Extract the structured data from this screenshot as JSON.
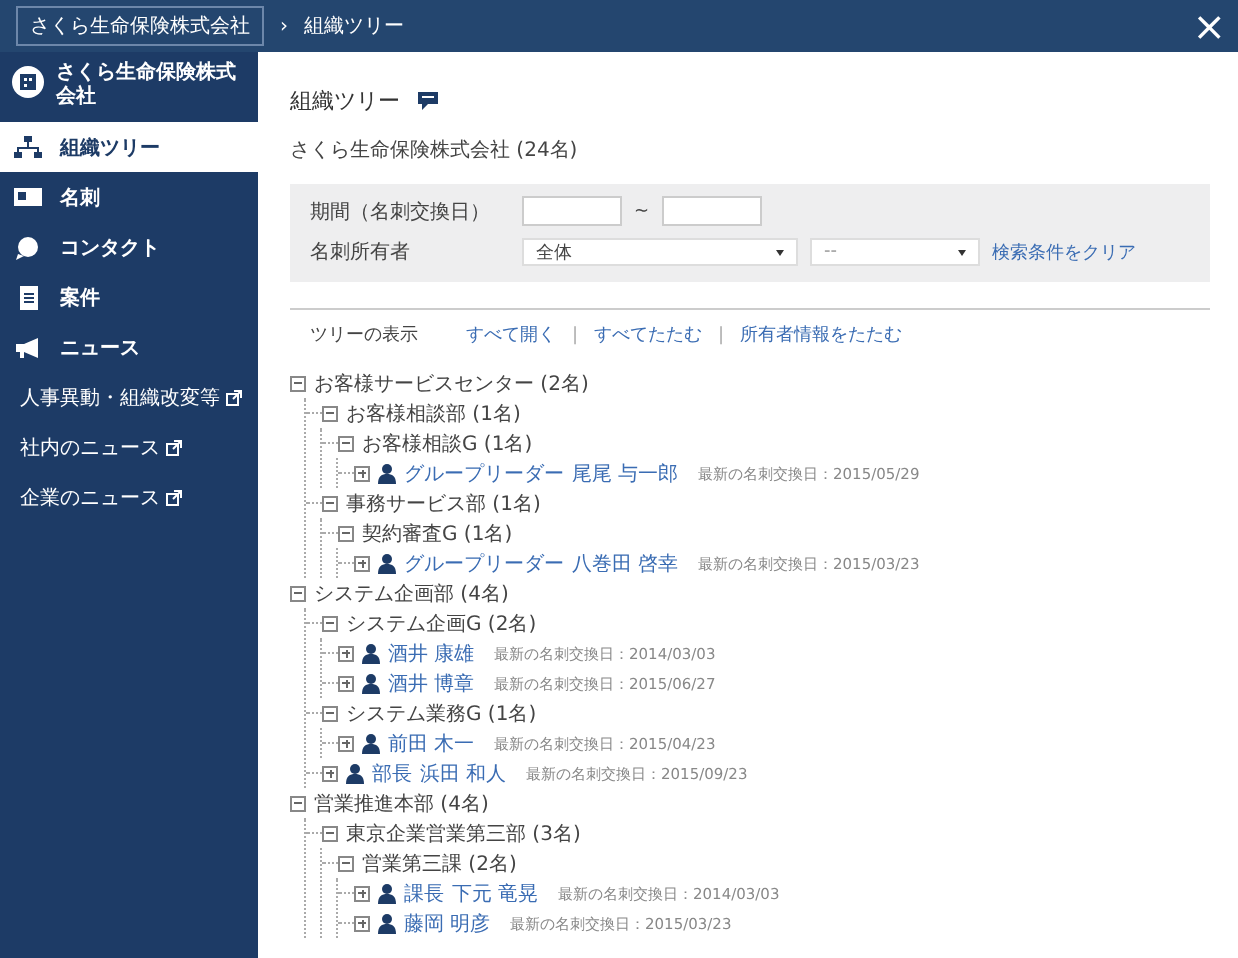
{
  "header": {
    "breadcrumb": [
      {
        "label": "さくら生命保険株式会社",
        "kind": "link"
      },
      {
        "label": "›",
        "kind": "separator"
      },
      {
        "label": "組織ツリー",
        "kind": "current"
      }
    ],
    "close": "×"
  },
  "sidebar": {
    "company": "さくら生命保険株式会社",
    "items": [
      {
        "label": "組織ツリー",
        "kind": "nav",
        "selected": true
      },
      {
        "label": "名刺",
        "kind": "nav",
        "selected": false
      },
      {
        "label": "コンタクト",
        "kind": "nav",
        "selected": false
      },
      {
        "label": "案件",
        "kind": "nav",
        "selected": false
      },
      {
        "label": "ニュース",
        "kind": "nav",
        "selected": false
      },
      {
        "label": "人事異動・組織改変等",
        "kind": "external",
        "selected": false
      },
      {
        "label": "社内のニュース",
        "kind": "external",
        "selected": false
      },
      {
        "label": "企業のニュース",
        "kind": "external",
        "selected": false
      }
    ]
  },
  "main": {
    "title": "組織ツリー",
    "company": "さくら生命保険株式会社 (24名)",
    "filter": {
      "period_label": "期間（名刺交換日）",
      "range_sep": "~",
      "owner_label": "名刺所有者",
      "owner_value": "全体",
      "owner_sub_value": "--",
      "clear_link": "検索条件をクリア"
    },
    "tree_display": {
      "label": "ツリーの表示",
      "separators": [
        "|",
        "|"
      ],
      "links": [
        "すべて開く",
        "すべてたたむ",
        "所有者情報をたたむ"
      ]
    },
    "tree": [
      {
        "kind": "group",
        "label": "お客様サービスセンター (2名)",
        "expanded": true,
        "children": [
          {
            "kind": "group",
            "label": "お客様相談部 (1名)",
            "expanded": true,
            "children": [
              {
                "kind": "group",
                "label": "お客様相談G (1名)",
                "expanded": true,
                "children": [
                  {
                    "kind": "person",
                    "title": "グループリーダー",
                    "name": "尾尾 与一郎",
                    "date": "最新の名刺交換日：2015/05/29",
                    "expanded": false
                  }
                ]
              }
            ]
          },
          {
            "kind": "group",
            "label": "事務サービス部 (1名)",
            "expanded": true,
            "children": [
              {
                "kind": "group",
                "label": "契約審査G (1名)",
                "expanded": true,
                "children": [
                  {
                    "kind": "person",
                    "title": "グループリーダー",
                    "name": "八巻田 啓幸",
                    "date": "最新の名刺交換日：2015/03/23",
                    "expanded": false
                  }
                ]
              }
            ]
          }
        ]
      },
      {
        "kind": "group",
        "label": "システム企画部 (4名)",
        "expanded": true,
        "children": [
          {
            "kind": "group",
            "label": "システム企画G (2名)",
            "expanded": true,
            "children": [
              {
                "kind": "person",
                "name": "酒井 康雄",
                "date": "最新の名刺交換日：2014/03/03",
                "expanded": false
              },
              {
                "kind": "person",
                "name": "酒井 博章",
                "date": "最新の名刺交換日：2015/06/27",
                "expanded": false
              }
            ]
          },
          {
            "kind": "group",
            "label": "システム業務G (1名)",
            "expanded": true,
            "children": [
              {
                "kind": "person",
                "name": "前田 木一",
                "date": "最新の名刺交換日：2015/04/23",
                "expanded": false
              }
            ]
          },
          {
            "kind": "person",
            "title": "部長",
            "name": "浜田 和人",
            "date": "最新の名刺交換日：2015/09/23",
            "expanded": false
          }
        ]
      },
      {
        "kind": "group",
        "label": "営業推進本部 (4名)",
        "expanded": true,
        "children": [
          {
            "kind": "group",
            "label": "東京企業営業第三部 (3名)",
            "expanded": true,
            "children": [
              {
                "kind": "group",
                "label": "営業第三課 (2名)",
                "expanded": true,
                "children": [
                  {
                    "kind": "person",
                    "title": "課長",
                    "name": "下元 竜晃",
                    "date": "最新の名刺交換日：2014/03/03",
                    "expanded": false
                  },
                  {
                    "kind": "person",
                    "name": "藤岡 明彦",
                    "date": "最新の名刺交換日：2015/03/23",
                    "expanded": false
                  }
                ]
              }
            ]
          }
        ]
      }
    ]
  }
}
